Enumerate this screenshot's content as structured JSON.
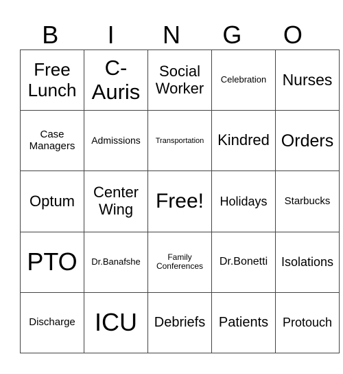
{
  "header": [
    "B",
    "I",
    "N",
    "G",
    "O"
  ],
  "rows": [
    [
      {
        "text": "Free Lunch",
        "size": 26
      },
      {
        "text": "C-Auris",
        "size": 31
      },
      {
        "text": "Social Worker",
        "size": 22
      },
      {
        "text": "Celebration",
        "size": 13
      },
      {
        "text": "Nurses",
        "size": 23
      }
    ],
    [
      {
        "text": "Case Managers",
        "size": 15
      },
      {
        "text": "Admissions",
        "size": 14
      },
      {
        "text": "Transportation",
        "size": 11
      },
      {
        "text": "Kindred",
        "size": 22
      },
      {
        "text": "Orders",
        "size": 25
      }
    ],
    [
      {
        "text": "Optum",
        "size": 22
      },
      {
        "text": "Center Wing",
        "size": 22
      },
      {
        "text": "Free!",
        "size": 30
      },
      {
        "text": "Holidays",
        "size": 18
      },
      {
        "text": "Starbucks",
        "size": 15
      }
    ],
    [
      {
        "text": "PTO",
        "size": 36
      },
      {
        "text": "Dr.Banafshe",
        "size": 13
      },
      {
        "text": "Family Conferences",
        "size": 12
      },
      {
        "text": "Dr.Bonetti",
        "size": 16
      },
      {
        "text": "Isolations",
        "size": 18
      }
    ],
    [
      {
        "text": "Discharge",
        "size": 15
      },
      {
        "text": "ICU",
        "size": 36
      },
      {
        "text": "Debriefs",
        "size": 20
      },
      {
        "text": "Patients",
        "size": 20
      },
      {
        "text": "Protouch",
        "size": 18
      }
    ]
  ]
}
